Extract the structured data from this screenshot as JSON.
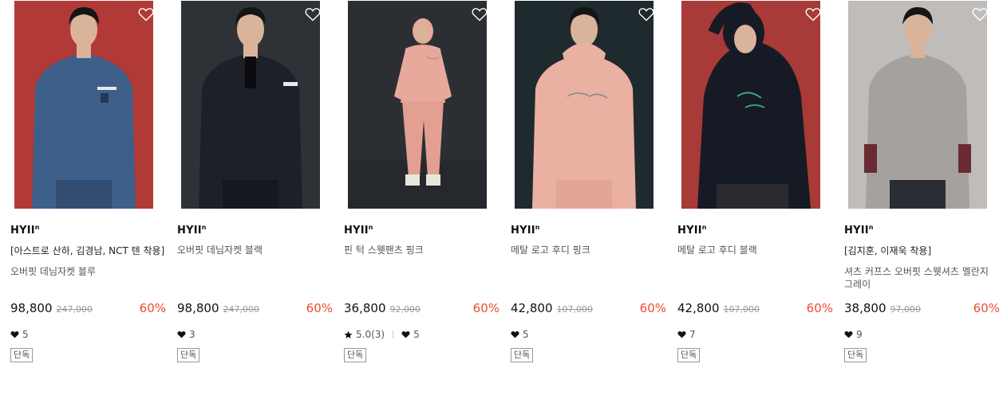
{
  "products": [
    {
      "brand": "HYII",
      "brand_sup": "n",
      "tagline": "[아스트로 산하, 김경남, NCT 텐 착용]",
      "name": "오버핏 데님자켓 블루",
      "price": "98,800",
      "original_price": "247,000",
      "discount": "60%",
      "likes": "5",
      "badge": "단독",
      "image": {
        "bg": "#b13a36",
        "garment": "#3e5f8a",
        "pants": "#324c72",
        "desc": "model-denim-jacket-blue"
      }
    },
    {
      "brand": "HYII",
      "brand_sup": "n",
      "tagline": "",
      "name": "오버핏 데님자켓 블랙",
      "price": "98,800",
      "original_price": "247,000",
      "discount": "60%",
      "likes": "3",
      "badge": "단독",
      "image": {
        "bg": "#2e3237",
        "garment": "#1c2028",
        "pants": "#151820",
        "desc": "model-denim-jacket-black"
      }
    },
    {
      "brand": "HYII",
      "brand_sup": "n",
      "tagline": "",
      "name": "핀 턱 스웻팬츠 핑크",
      "price": "36,800",
      "original_price": "92,000",
      "discount": "60%",
      "rating": "5.0(3)",
      "likes": "5",
      "badge": "단독",
      "image": {
        "bg": "#2b2f33",
        "garment": "#e7a99b",
        "pants": "#e29f92",
        "desc": "model-pink-sweatpants"
      }
    },
    {
      "brand": "HYII",
      "brand_sup": "n",
      "tagline": "",
      "name": "메탈 로고 후디 핑크",
      "price": "42,800",
      "original_price": "107,000",
      "discount": "60%",
      "likes": "5",
      "badge": "단독",
      "image": {
        "bg": "#1f2a2e",
        "garment": "#eab0a1",
        "pants": "#e0a595",
        "desc": "model-pink-hoodie"
      }
    },
    {
      "brand": "HYII",
      "brand_sup": "n",
      "tagline": "",
      "name": "메탈 로고 후디 블랙",
      "price": "42,800",
      "original_price": "107,000",
      "discount": "60%",
      "likes": "7",
      "badge": "단독",
      "image": {
        "bg": "#a83a38",
        "garment": "#161a24",
        "pants": "#2a2a30",
        "desc": "model-black-hoodie"
      }
    },
    {
      "brand": "HYII",
      "brand_sup": "n",
      "tagline": "[김지훈, 이재욱 착용]",
      "name": "셔츠 커프스 오버핏 스웻셔츠 멜란지 그레이",
      "price": "38,800",
      "original_price": "97,000",
      "discount": "60%",
      "likes": "9",
      "badge": "단독",
      "image": {
        "bg": "#bfbcba",
        "garment": "#a4a19e",
        "pants": "#2a2d35",
        "desc": "model-grey-sweatshirt"
      }
    }
  ],
  "colors": {
    "discount": "#f04a2f",
    "text": "#111111",
    "muted": "#555555",
    "strike": "#999999"
  },
  "icons": {
    "wishlist": "heart-outline-icon",
    "likes": "heart-filled-icon",
    "rating": "star-filled-icon"
  }
}
